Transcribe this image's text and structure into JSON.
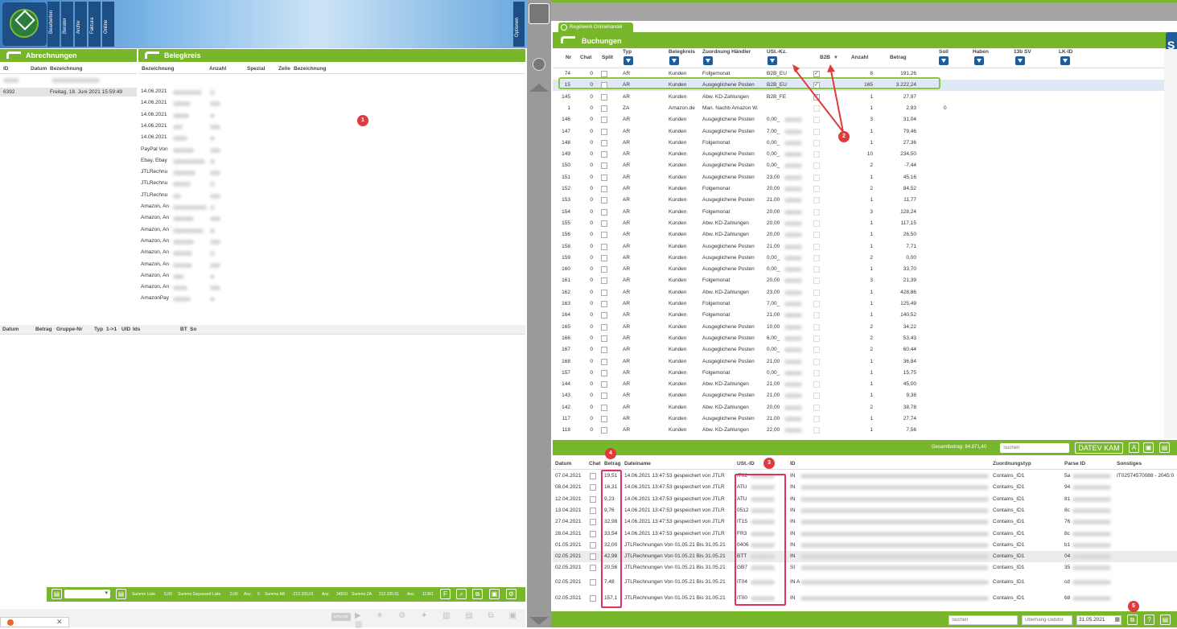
{
  "left": {
    "tabs": [
      "Bearbeiten",
      "Berater",
      "Archiv",
      "Faktura",
      "Online"
    ],
    "options_label": "Optionen",
    "panel1_title": "Abrechnungen",
    "panel2_title": "Belegkreis",
    "abr_headers": [
      "ID",
      "Datum",
      "Bezeichnung"
    ],
    "abr_row": {
      "id": "6392",
      "date": "Freitag, 18. Juni 2021 15:59:49"
    },
    "beleg_headers": [
      "Bezeichnung",
      "Anzahl",
      "Spezial",
      "Zeile",
      "Bezeichnung"
    ],
    "beleg_rows": [
      "14.06.2021",
      "14.06.2021",
      "14.06.2021",
      "14.06.2021",
      "14.06.2021",
      "PayPal Von",
      "Ebay, Ebay",
      "JTLRechnu",
      "JTLRechnu",
      "JTLRechnu",
      "Amazon, An",
      "Amazon, An",
      "Amazon, An",
      "Amazon, An",
      "Amazon, An",
      "Amazon, An",
      "Amazon, An",
      "Amazon, An",
      "AmazonPay"
    ],
    "bottom_headers": [
      "Datum",
      "Betrag",
      "Gruppe-Nr",
      "Typ",
      "1->1",
      "UID",
      "Ids",
      "BT",
      "So"
    ],
    "footer": {
      "summe_liste_label": "Summe Liste",
      "summe_liste": "0,00",
      "summe_gepassed_label": "Summe Gepassed Liste",
      "summe_gepassed": "0,00",
      "anz1_label": "Anz.",
      "anz1": "0",
      "summe_ar_label": "Summe AR",
      "summe_ar": "-212.330,01",
      "anz2_label": "Anz.",
      "anz2": "34910",
      "summe_za_label": "Summe ZA",
      "summe_za": "212.330,01",
      "anz3_label": "Anz.",
      "anz3": "11381"
    },
    "update_label": "UPDATE"
  },
  "right": {
    "tab_label": "Regelwerk Onlinehandel",
    "title": "Buchungen",
    "headers": [
      "Nr",
      "Chat",
      "Split",
      "Typ",
      "Belegkreis",
      "Zuordnung Händler",
      "USt.-Kz.",
      "B2B",
      "Anzahl",
      "Betrag",
      "Soll",
      "Haben",
      "13b SV",
      "LK-ID"
    ],
    "rows": [
      {
        "nr": "74",
        "chat": "0",
        "typ": "AR",
        "bk": "Kunden",
        "zh": "Folgemonat",
        "ust": "B2B_EU",
        "b2b": true,
        "anz": "8",
        "betrag": "191,26",
        "soll": ""
      },
      {
        "nr": "15",
        "chat": "0",
        "typ": "AR",
        "bk": "Kunden",
        "zh": "Ausgeglichene Posten",
        "ust": "B2B_EU",
        "b2b": true,
        "anz": "165",
        "betrag": "3.222,24",
        "soll": ""
      },
      {
        "nr": "145",
        "chat": "0",
        "typ": "AR",
        "bk": "Kunden",
        "zh": "Abw. KD-Zahlungen",
        "ust": "B2B_FE",
        "b2b": true,
        "anz": "1",
        "betrag": "27,97",
        "soll": ""
      },
      {
        "nr": "1",
        "chat": "0",
        "typ": "ZA",
        "bk": "Amazon.de",
        "zh": "Man. Nachb Amazon W.",
        "ust": "",
        "b2b": false,
        "anz": "1",
        "betrag": "2,93",
        "soll": "0"
      },
      {
        "nr": "146",
        "chat": "0",
        "typ": "AR",
        "bk": "Kunden",
        "zh": "Ausgeglichene Posten",
        "ust": "0,00_",
        "b2b": false,
        "anz": "3",
        "betrag": "31,04",
        "soll": ""
      },
      {
        "nr": "147",
        "chat": "0",
        "typ": "AR",
        "bk": "Kunden",
        "zh": "Ausgeglichene Posten",
        "ust": "7,00_",
        "b2b": false,
        "anz": "1",
        "betrag": "79,46",
        "soll": ""
      },
      {
        "nr": "148",
        "chat": "0",
        "typ": "AR",
        "bk": "Kunden",
        "zh": "Folgemonat",
        "ust": "0,00_",
        "b2b": false,
        "anz": "1",
        "betrag": "27,36",
        "soll": ""
      },
      {
        "nr": "149",
        "chat": "0",
        "typ": "AR",
        "bk": "Kunden",
        "zh": "Ausgeglichene Posten",
        "ust": "0,00_",
        "b2b": false,
        "anz": "10",
        "betrag": "234,50",
        "soll": ""
      },
      {
        "nr": "150",
        "chat": "0",
        "typ": "AR",
        "bk": "Kunden",
        "zh": "Ausgeglichene Posten",
        "ust": "0,00_",
        "b2b": false,
        "anz": "2",
        "betrag": "-7,44",
        "soll": ""
      },
      {
        "nr": "151",
        "chat": "0",
        "typ": "AR",
        "bk": "Kunden",
        "zh": "Ausgeglichene Posten",
        "ust": "23,00",
        "b2b": false,
        "anz": "1",
        "betrag": "45,16",
        "soll": ""
      },
      {
        "nr": "152",
        "chat": "0",
        "typ": "AR",
        "bk": "Kunden",
        "zh": "Folgemonat",
        "ust": "20,00",
        "b2b": false,
        "anz": "2",
        "betrag": "84,52",
        "soll": ""
      },
      {
        "nr": "153",
        "chat": "0",
        "typ": "AR",
        "bk": "Kunden",
        "zh": "Ausgeglichene Posten",
        "ust": "21,00",
        "b2b": false,
        "anz": "1",
        "betrag": "11,77",
        "soll": ""
      },
      {
        "nr": "154",
        "chat": "0",
        "typ": "AR",
        "bk": "Kunden",
        "zh": "Folgemonat",
        "ust": "20,00",
        "b2b": false,
        "anz": "3",
        "betrag": "128,24",
        "soll": ""
      },
      {
        "nr": "155",
        "chat": "0",
        "typ": "AR",
        "bk": "Kunden",
        "zh": "Abw. KD-Zahlungen",
        "ust": "20,00",
        "b2b": false,
        "anz": "1",
        "betrag": "117,15",
        "soll": ""
      },
      {
        "nr": "156",
        "chat": "0",
        "typ": "AR",
        "bk": "Kunden",
        "zh": "Abw. KD-Zahlungen",
        "ust": "20,00",
        "b2b": false,
        "anz": "1",
        "betrag": "26,50",
        "soll": ""
      },
      {
        "nr": "158",
        "chat": "0",
        "typ": "AR",
        "bk": "Kunden",
        "zh": "Ausgeglichene Posten",
        "ust": "21,00",
        "b2b": false,
        "anz": "1",
        "betrag": "7,71",
        "soll": ""
      },
      {
        "nr": "159",
        "chat": "0",
        "typ": "AR",
        "bk": "Kunden",
        "zh": "Ausgeglichene Posten",
        "ust": "0,00_",
        "b2b": false,
        "anz": "2",
        "betrag": "0,00",
        "soll": ""
      },
      {
        "nr": "160",
        "chat": "0",
        "typ": "AR",
        "bk": "Kunden",
        "zh": "Ausgeglichene Posten",
        "ust": "0,00_",
        "b2b": false,
        "anz": "1",
        "betrag": "33,70",
        "soll": ""
      },
      {
        "nr": "161",
        "chat": "0",
        "typ": "AR",
        "bk": "Kunden",
        "zh": "Folgemonat",
        "ust": "20,00",
        "b2b": false,
        "anz": "3",
        "betrag": "21,39",
        "soll": ""
      },
      {
        "nr": "162",
        "chat": "0",
        "typ": "AR",
        "bk": "Kunden",
        "zh": "Abw. KD-Zahlungen",
        "ust": "23,00",
        "b2b": false,
        "anz": "1",
        "betrag": "428,86",
        "soll": ""
      },
      {
        "nr": "163",
        "chat": "0",
        "typ": "AR",
        "bk": "Kunden",
        "zh": "Folgemonat",
        "ust": "7,00_",
        "b2b": false,
        "anz": "1",
        "betrag": "125,49",
        "soll": ""
      },
      {
        "nr": "164",
        "chat": "0",
        "typ": "AR",
        "bk": "Kunden",
        "zh": "Folgemonat",
        "ust": "21,00",
        "b2b": false,
        "anz": "1",
        "betrag": "140,52",
        "soll": ""
      },
      {
        "nr": "165",
        "chat": "0",
        "typ": "AR",
        "bk": "Kunden",
        "zh": "Ausgeglichene Posten",
        "ust": "10,00",
        "b2b": false,
        "anz": "2",
        "betrag": "34,22",
        "soll": ""
      },
      {
        "nr": "166",
        "chat": "0",
        "typ": "AR",
        "bk": "Kunden",
        "zh": "Ausgeglichene Posten",
        "ust": "6,00_",
        "b2b": false,
        "anz": "2",
        "betrag": "53,43",
        "soll": ""
      },
      {
        "nr": "167",
        "chat": "0",
        "typ": "AR",
        "bk": "Kunden",
        "zh": "Ausgeglichene Posten",
        "ust": "0,00_",
        "b2b": false,
        "anz": "2",
        "betrag": "60,44",
        "soll": ""
      },
      {
        "nr": "168",
        "chat": "0",
        "typ": "AR",
        "bk": "Kunden",
        "zh": "Ausgeglichene Posten",
        "ust": "21,00",
        "b2b": false,
        "anz": "1",
        "betrag": "36,84",
        "soll": ""
      },
      {
        "nr": "157",
        "chat": "0",
        "typ": "AR",
        "bk": "Kunden",
        "zh": "Folgemonat",
        "ust": "0,00_",
        "b2b": false,
        "anz": "1",
        "betrag": "15,75",
        "soll": ""
      },
      {
        "nr": "144",
        "chat": "0",
        "typ": "AR",
        "bk": "Kunden",
        "zh": "Abw. KD-Zahlungen",
        "ust": "21,00",
        "b2b": false,
        "anz": "1",
        "betrag": "45,00",
        "soll": ""
      },
      {
        "nr": "143",
        "chat": "0",
        "typ": "AR",
        "bk": "Kunden",
        "zh": "Ausgeglichene Posten",
        "ust": "21,00",
        "b2b": false,
        "anz": "1",
        "betrag": "9,38",
        "soll": ""
      },
      {
        "nr": "142",
        "chat": "0",
        "typ": "AR",
        "bk": "Kunden",
        "zh": "Abw. KD-Zahlungen",
        "ust": "20,00",
        "b2b": false,
        "anz": "2",
        "betrag": "38,78",
        "soll": ""
      },
      {
        "nr": "117",
        "chat": "0",
        "typ": "AR",
        "bk": "Kunden",
        "zh": "Ausgeglichene Posten",
        "ust": "21,00",
        "b2b": false,
        "anz": "1",
        "betrag": "27,74",
        "soll": ""
      },
      {
        "nr": "118",
        "chat": "0",
        "typ": "AR",
        "bk": "Kunden",
        "zh": "Abw. KD-Zahlungen",
        "ust": "22,00",
        "b2b": false,
        "anz": "1",
        "betrag": "7,56",
        "soll": ""
      }
    ],
    "gesamt_label": "Gesamtbetrag: 84.871,40",
    "search_placeholder": "Suchen",
    "datev_label": "DATEV KAM",
    "btn_a": "A",
    "bottom_headers": [
      "Datum",
      "Chat",
      "Betrag",
      "Dateiname",
      "USt.-ID",
      "ID",
      "Zuordnungstyp",
      "Parse ID",
      "Sonstiges"
    ],
    "bottom_rows": [
      {
        "datum": "07.04.2021",
        "betrag": "19,51",
        "datei": "14.06.2021 13:47:53 gespeichert von JTLR",
        "ust": "IT02",
        "id": "IN",
        "zt": "Contains_ID1",
        "pid": "5a",
        "so": "IT02574570088 - 2045:0"
      },
      {
        "datum": "08.04.2021",
        "betrag": "16,31",
        "datei": "14.06.2021 13:47:53 gespeichert von JTLR",
        "ust": "ATU",
        "id": "IN",
        "zt": "Contains_ID1",
        "pid": "94",
        "so": ""
      },
      {
        "datum": "12.04.2021",
        "betrag": "9,23",
        "datei": "14.06.2021 13:47:53 gespeichert von JTLR",
        "ust": "ATU",
        "id": "IN",
        "zt": "Contains_ID1",
        "pid": "81",
        "so": ""
      },
      {
        "datum": "13.04.2021",
        "betrag": "9,76",
        "datei": "14.06.2021 13:47:53 gespeichert von JTLR",
        "ust": "0512",
        "id": "IN",
        "zt": "Contains_ID1",
        "pid": "8c",
        "so": ""
      },
      {
        "datum": "27.04.2021",
        "betrag": "32,98",
        "datei": "14.06.2021 13:47:53 gespeichert von JTLR",
        "ust": "IT15",
        "id": "IN",
        "zt": "Contains_ID1",
        "pid": "76",
        "so": ""
      },
      {
        "datum": "28.04.2021",
        "betrag": "33,54",
        "datei": "14.06.2021 13:47:53 gespeichert von JTLR",
        "ust": "FR3",
        "id": "IN",
        "zt": "Contains_ID1",
        "pid": "8c",
        "so": ""
      },
      {
        "datum": "01.05.2021",
        "betrag": "32,00",
        "datei": "JTLRechnungen Von 01.05.21 Bis 31.05.21",
        "ust": "0406",
        "id": "IN",
        "zt": "Contains_ID1",
        "pid": "b1",
        "so": ""
      },
      {
        "datum": "02.05.2021",
        "betrag": "42,98",
        "datei": "JTLRechnungen Von 01.05.21 Bis 31.05.21",
        "ust": "BTT",
        "id": "IN",
        "zt": "Contains_ID1",
        "pid": "04",
        "so": ""
      },
      {
        "datum": "02.05.2021",
        "betrag": "20,56",
        "datei": "JTLRechnungen Von 01.05.21 Bis 31.05.21",
        "ust": "GB7",
        "id": "SI",
        "zt": "Contains_ID1",
        "pid": "35",
        "so": ""
      },
      {
        "datum": "02.05.2021",
        "betrag": "7,48",
        "datei": "JTLRechnungen Von 01.05.21 Bis 31.05.21",
        "ust": "IT04",
        "id": "IN Ar",
        "zt": "Contains_ID1",
        "pid": "cd",
        "so": ""
      },
      {
        "datum": "02.05.2021",
        "betrag": "157,1",
        "datei": "JTLRechnungen Von 01.05.21 Bis 31.05.21",
        "ust": "IT00",
        "id": "IN",
        "zt": "Contains_ID1",
        "pid": "68",
        "so": ""
      }
    ],
    "status": {
      "search_placeholder": "Suchen",
      "debitor_placeholder": "Überhang-Debitor",
      "date": "31.05.2021"
    }
  },
  "badges": [
    "1",
    "2",
    "3",
    "4",
    "5"
  ],
  "colors": {
    "green": "#78b62c",
    "blue": "#1e5d9a",
    "red": "#e0393e",
    "pink": "#e2335f"
  }
}
